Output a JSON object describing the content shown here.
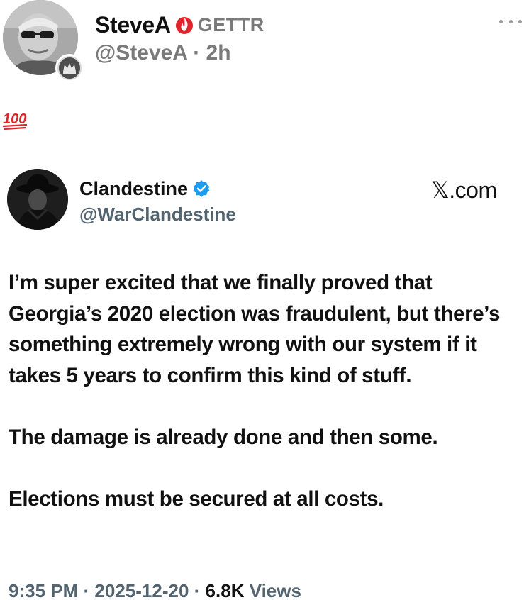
{
  "outer_post": {
    "author_name": "SteveA",
    "platform_label": "GETTR",
    "handle": "@SteveA",
    "separator": "·",
    "time_ago": "2h",
    "reaction_emoji": "hundred-points-emoji"
  },
  "embedded_post": {
    "author_name": "Clandestine",
    "handle": "@WarClandestine",
    "source": "𝕏.com",
    "paragraphs": [
      "I’m super excited that we finally proved that Georgia’s 2020 election was fraudulent, but there’s something extremely wrong with our system if it takes 5 years to confirm this kind of stuff.",
      "The damage is already done and then some.",
      "Elections must be secured at all costs."
    ],
    "time": "9:35 PM",
    "date": "2025-12-20",
    "separator": "·",
    "views_count": "6.8K",
    "views_label": "Views"
  },
  "colors": {
    "verified_blue": "#1d9bf0",
    "flame_red": "#e0262b",
    "muted_gray": "#7a7a7a",
    "x_gray": "#536471"
  }
}
